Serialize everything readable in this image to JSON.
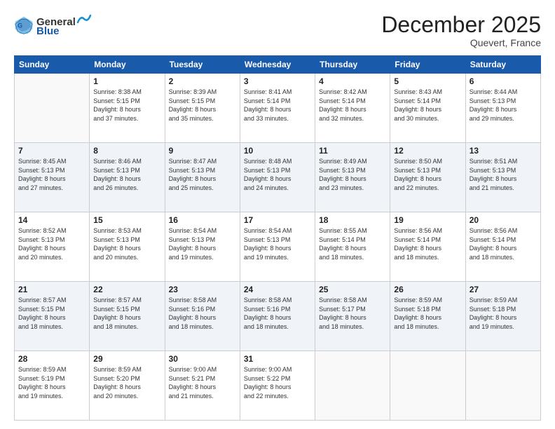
{
  "logo": {
    "general": "General",
    "blue": "Blue"
  },
  "header": {
    "month": "December 2025",
    "location": "Quevert, France"
  },
  "weekdays": [
    "Sunday",
    "Monday",
    "Tuesday",
    "Wednesday",
    "Thursday",
    "Friday",
    "Saturday"
  ],
  "weeks": [
    [
      {
        "day": "",
        "info": ""
      },
      {
        "day": "1",
        "info": "Sunrise: 8:38 AM\nSunset: 5:15 PM\nDaylight: 8 hours\nand 37 minutes."
      },
      {
        "day": "2",
        "info": "Sunrise: 8:39 AM\nSunset: 5:15 PM\nDaylight: 8 hours\nand 35 minutes."
      },
      {
        "day": "3",
        "info": "Sunrise: 8:41 AM\nSunset: 5:14 PM\nDaylight: 8 hours\nand 33 minutes."
      },
      {
        "day": "4",
        "info": "Sunrise: 8:42 AM\nSunset: 5:14 PM\nDaylight: 8 hours\nand 32 minutes."
      },
      {
        "day": "5",
        "info": "Sunrise: 8:43 AM\nSunset: 5:14 PM\nDaylight: 8 hours\nand 30 minutes."
      },
      {
        "day": "6",
        "info": "Sunrise: 8:44 AM\nSunset: 5:13 PM\nDaylight: 8 hours\nand 29 minutes."
      }
    ],
    [
      {
        "day": "7",
        "info": "Sunrise: 8:45 AM\nSunset: 5:13 PM\nDaylight: 8 hours\nand 27 minutes."
      },
      {
        "day": "8",
        "info": "Sunrise: 8:46 AM\nSunset: 5:13 PM\nDaylight: 8 hours\nand 26 minutes."
      },
      {
        "day": "9",
        "info": "Sunrise: 8:47 AM\nSunset: 5:13 PM\nDaylight: 8 hours\nand 25 minutes."
      },
      {
        "day": "10",
        "info": "Sunrise: 8:48 AM\nSunset: 5:13 PM\nDaylight: 8 hours\nand 24 minutes."
      },
      {
        "day": "11",
        "info": "Sunrise: 8:49 AM\nSunset: 5:13 PM\nDaylight: 8 hours\nand 23 minutes."
      },
      {
        "day": "12",
        "info": "Sunrise: 8:50 AM\nSunset: 5:13 PM\nDaylight: 8 hours\nand 22 minutes."
      },
      {
        "day": "13",
        "info": "Sunrise: 8:51 AM\nSunset: 5:13 PM\nDaylight: 8 hours\nand 21 minutes."
      }
    ],
    [
      {
        "day": "14",
        "info": "Sunrise: 8:52 AM\nSunset: 5:13 PM\nDaylight: 8 hours\nand 20 minutes."
      },
      {
        "day": "15",
        "info": "Sunrise: 8:53 AM\nSunset: 5:13 PM\nDaylight: 8 hours\nand 20 minutes."
      },
      {
        "day": "16",
        "info": "Sunrise: 8:54 AM\nSunset: 5:13 PM\nDaylight: 8 hours\nand 19 minutes."
      },
      {
        "day": "17",
        "info": "Sunrise: 8:54 AM\nSunset: 5:13 PM\nDaylight: 8 hours\nand 19 minutes."
      },
      {
        "day": "18",
        "info": "Sunrise: 8:55 AM\nSunset: 5:14 PM\nDaylight: 8 hours\nand 18 minutes."
      },
      {
        "day": "19",
        "info": "Sunrise: 8:56 AM\nSunset: 5:14 PM\nDaylight: 8 hours\nand 18 minutes."
      },
      {
        "day": "20",
        "info": "Sunrise: 8:56 AM\nSunset: 5:14 PM\nDaylight: 8 hours\nand 18 minutes."
      }
    ],
    [
      {
        "day": "21",
        "info": "Sunrise: 8:57 AM\nSunset: 5:15 PM\nDaylight: 8 hours\nand 18 minutes."
      },
      {
        "day": "22",
        "info": "Sunrise: 8:57 AM\nSunset: 5:15 PM\nDaylight: 8 hours\nand 18 minutes."
      },
      {
        "day": "23",
        "info": "Sunrise: 8:58 AM\nSunset: 5:16 PM\nDaylight: 8 hours\nand 18 minutes."
      },
      {
        "day": "24",
        "info": "Sunrise: 8:58 AM\nSunset: 5:16 PM\nDaylight: 8 hours\nand 18 minutes."
      },
      {
        "day": "25",
        "info": "Sunrise: 8:58 AM\nSunset: 5:17 PM\nDaylight: 8 hours\nand 18 minutes."
      },
      {
        "day": "26",
        "info": "Sunrise: 8:59 AM\nSunset: 5:18 PM\nDaylight: 8 hours\nand 18 minutes."
      },
      {
        "day": "27",
        "info": "Sunrise: 8:59 AM\nSunset: 5:18 PM\nDaylight: 8 hours\nand 19 minutes."
      }
    ],
    [
      {
        "day": "28",
        "info": "Sunrise: 8:59 AM\nSunset: 5:19 PM\nDaylight: 8 hours\nand 19 minutes."
      },
      {
        "day": "29",
        "info": "Sunrise: 8:59 AM\nSunset: 5:20 PM\nDaylight: 8 hours\nand 20 minutes."
      },
      {
        "day": "30",
        "info": "Sunrise: 9:00 AM\nSunset: 5:21 PM\nDaylight: 8 hours\nand 21 minutes."
      },
      {
        "day": "31",
        "info": "Sunrise: 9:00 AM\nSunset: 5:22 PM\nDaylight: 8 hours\nand 22 minutes."
      },
      {
        "day": "",
        "info": ""
      },
      {
        "day": "",
        "info": ""
      },
      {
        "day": "",
        "info": ""
      }
    ]
  ]
}
